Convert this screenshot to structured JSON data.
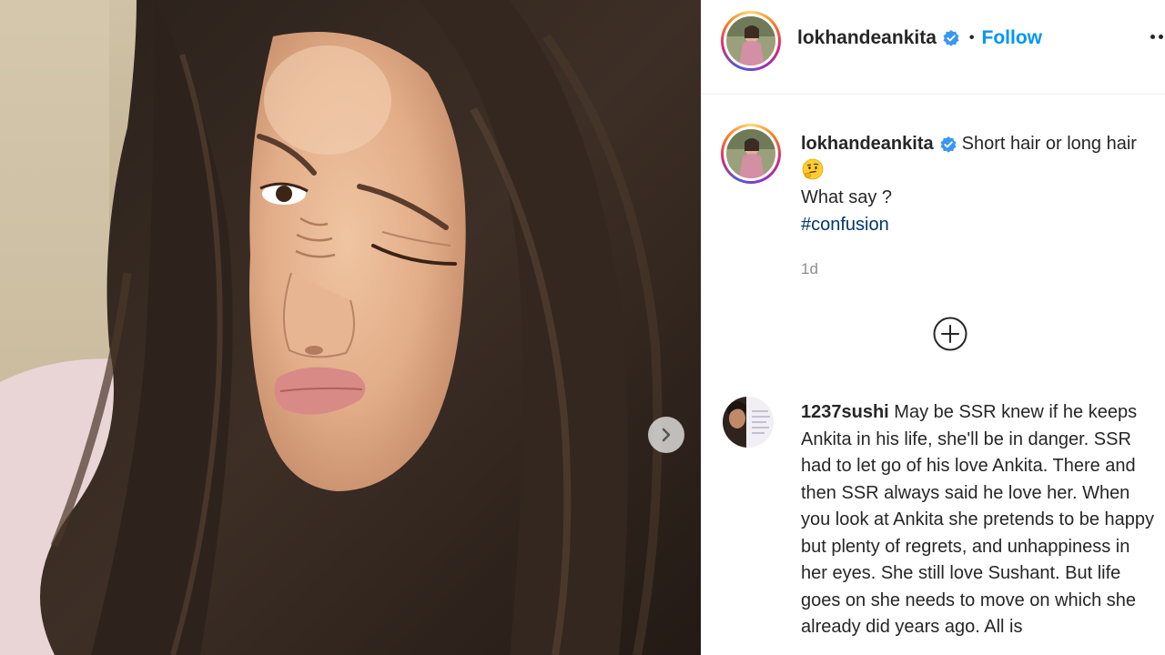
{
  "post": {
    "username": "lokhandeankita",
    "follow_label": "Follow",
    "separator": "•",
    "caption": {
      "line1": "Short hair or long hair",
      "line2": "What say ?",
      "hashtag": "#confusion",
      "emoji": "thinking-face-emoji"
    },
    "timestamp": "1d",
    "verified_color": "#3897f0"
  },
  "comments": [
    {
      "username": "1237sushi",
      "text": "May be SSR knew if he keeps Ankita in his life, she'll be in danger. SSR had to let go of his love Ankita. There and then SSR always said he love her. When you look at Ankita she pretends to be happy but plenty of regrets, and unhappiness in her eyes. She still love Sushant. But life goes on she needs to move on which she already did years ago. All is"
    }
  ],
  "icons": {
    "next": "chevron-right-icon",
    "more": "more-options-icon",
    "add_comment": "add-circle-icon",
    "verified": "verified-badge-icon"
  },
  "colors": {
    "accent": "#0095f6",
    "text": "#262626",
    "muted": "#8e8e8e",
    "hashtag": "#00376b"
  }
}
